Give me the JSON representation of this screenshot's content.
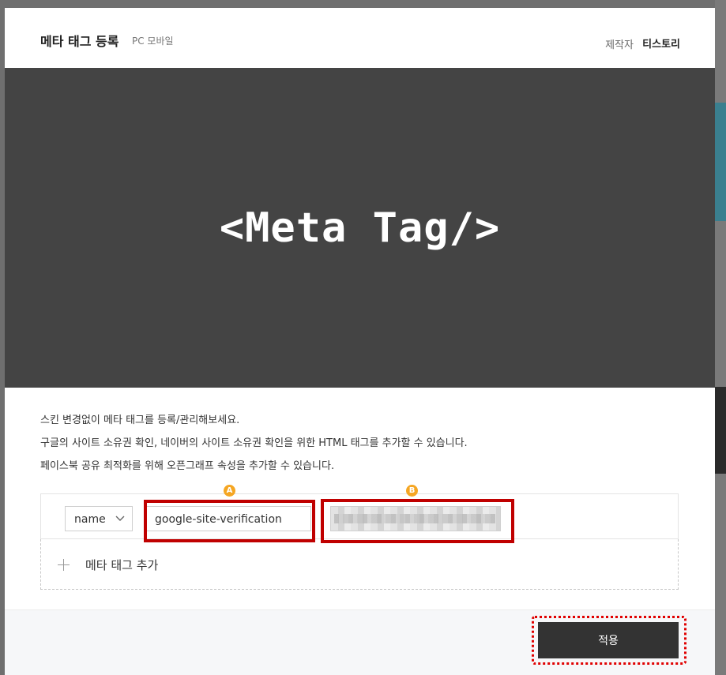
{
  "modal": {
    "title": "메타 태그 등록",
    "subtitle": "PC 모바일",
    "author_label": "제작자",
    "author_name": "티스토리"
  },
  "banner": {
    "text": "<Meta Tag/>"
  },
  "description": [
    "스킨 변경없이 메타 태그를 등록/관리해보세요.",
    "구글의 사이트 소유권 확인, 네이버의 사이트 소유권 확인을 위한 HTML 태그를 추가할 수 있습니다.",
    "페이스북 공유 최적화를 위해 오픈그래프 속성을 추가할 수 있습니다."
  ],
  "tag_row": {
    "attribute_select": "name",
    "name_value": "google-site-verification",
    "content_value": "",
    "badge_a": "A",
    "badge_b": "B"
  },
  "add_tag_label": "메타 태그 추가",
  "apply_label": "적용",
  "colors": {
    "banner_bg": "#444444",
    "highlight": "#c00000",
    "badge": "#f5a623",
    "apply_bg": "#333333"
  },
  "icons": [
    "chevron-down-icon",
    "plus-icon"
  ]
}
